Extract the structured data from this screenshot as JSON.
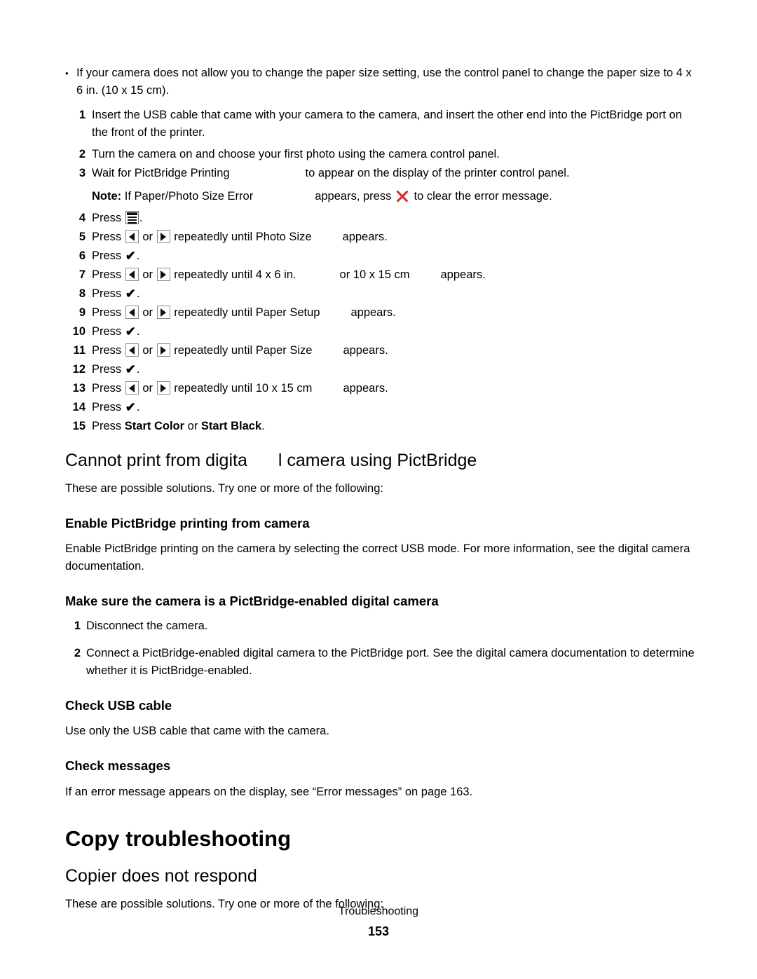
{
  "document": {
    "footer_label": "Troubleshooting",
    "page_number": "153",
    "accent_red": "#e8231f"
  },
  "intro_bullet": {
    "marker": "•",
    "text": "If your camera does not allow you to change the paper size setting, use the control panel to change the paper size to 4 x 6 in. (10 x 15 cm)."
  },
  "steps": [
    {
      "num": "1",
      "text": "Insert the USB cable that came with your camera to the camera, and insert the other end into the PictBridge port on the front of the printer."
    },
    {
      "num": "2",
      "text": "Turn the camera on and choose your first photo using the camera control panel."
    },
    {
      "num": "3",
      "prefix": "Wait for PictBridge Printing",
      "suffix": "to appear on the display of the printer control panel."
    }
  ],
  "note": {
    "label": "Note:",
    "prefix": "If Paper/Photo Size Error",
    "middle": "appears, press",
    "icon": "cancel-x-icon",
    "suffix": "to clear the error message."
  },
  "press_steps": [
    {
      "num": "4",
      "press": "Press",
      "icons": [
        "menu-icon"
      ],
      "tail": "."
    },
    {
      "num": "5",
      "press": "Press",
      "icons": [
        "left-arrow-icon",
        "right-arrow-icon"
      ],
      "conj": "or",
      "middle": "repeatedly until Photo Size",
      "tail": "appears."
    },
    {
      "num": "6",
      "press": "Press",
      "icons": [
        "checkmark-icon"
      ],
      "tail": "."
    },
    {
      "num": "7",
      "press": "Press",
      "icons": [
        "left-arrow-icon",
        "right-arrow-icon"
      ],
      "conj": "or",
      "middle": "repeatedly until 4 x 6 in.",
      "middle2": "or 10 x 15 cm",
      "tail": "appears."
    },
    {
      "num": "8",
      "press": "Press",
      "icons": [
        "checkmark-icon"
      ],
      "tail": "."
    },
    {
      "num": "9",
      "press": "Press",
      "icons": [
        "left-arrow-icon",
        "right-arrow-icon"
      ],
      "conj": "or",
      "middle": "repeatedly until Paper Setup",
      "tail": "appears."
    },
    {
      "num": "10",
      "press": "Press",
      "icons": [
        "checkmark-icon"
      ],
      "tail": "."
    },
    {
      "num": "11",
      "press": "Press",
      "icons": [
        "left-arrow-icon",
        "right-arrow-icon"
      ],
      "conj": "or",
      "middle": "repeatedly until Paper Size",
      "tail": "appears."
    },
    {
      "num": "12",
      "press": "Press",
      "icons": [
        "checkmark-icon"
      ],
      "tail": "."
    },
    {
      "num": "13",
      "press": "Press",
      "icons": [
        "left-arrow-icon",
        "right-arrow-icon"
      ],
      "conj": "or",
      "middle": "repeatedly until 10 x 15 cm",
      "tail": "appears."
    },
    {
      "num": "14",
      "press": "Press",
      "icons": [
        "checkmark-icon"
      ],
      "tail": "."
    },
    {
      "num": "15",
      "press": "Press",
      "bold1": "Start Color",
      "conj": "or",
      "bold2": "Start Black",
      "tail": "."
    }
  ],
  "section_pictbridge": {
    "heading_part1": "Cannot print from digita",
    "heading_part2": "l camera using PictBridge",
    "intro": "These are possible solutions. Try one or more of the following:",
    "sub1_heading": "Enable PictBridge printing from camera",
    "sub1_body": "Enable PictBridge printing on the camera by selecting the correct USB mode. For more information, see the digital camera documentation.",
    "sub2_heading": "Make sure the camera is a PictBridge-enabled digital camera",
    "sub2_steps": [
      {
        "num": "1",
        "text": "Disconnect the camera."
      },
      {
        "num": "2",
        "text": "Connect a PictBridge-enabled digital camera to the PictBridge port. See the digital camera documentation to determine whether it is PictBridge-enabled."
      }
    ],
    "sub3_heading": "Check USB cable",
    "sub3_body": "Use only the USB cable that came with the camera.",
    "sub4_heading": "Check messages",
    "sub4_body": "If an error message appears on the display, see “Error messages” on page 163."
  },
  "section_copy": {
    "heading": "Copy troubleshooting",
    "sub_heading": "Copier does not respond",
    "intro": "These are possible solutions. Try one or more of the following:"
  }
}
